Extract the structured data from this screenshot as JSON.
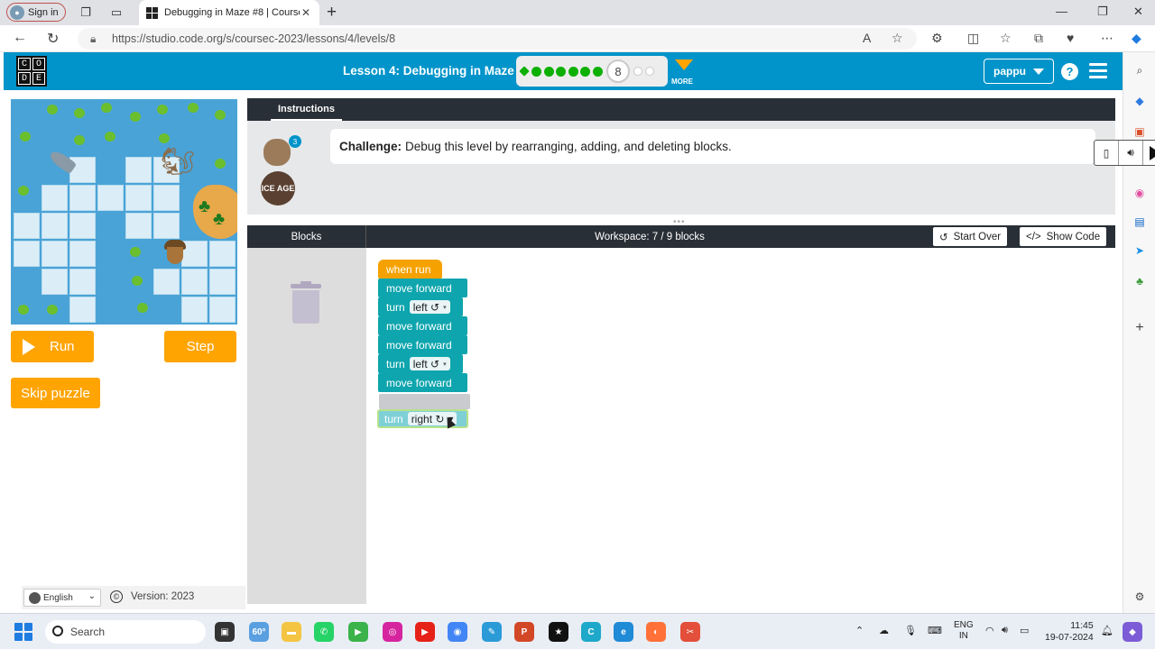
{
  "browser": {
    "signin_label": "Sign in",
    "tab_title": "Debugging in Maze #8 | Course C",
    "url": "https://studio.code.org/s/coursec-2023/lessons/4/levels/8"
  },
  "header": {
    "logo_letters": [
      "C",
      "O",
      "D",
      "E"
    ],
    "lesson_title": "Lesson 4: Debugging in Maze",
    "progress": {
      "completed_levels": 7,
      "current_level": "8",
      "remaining_levels": 2
    },
    "more_label": "MORE",
    "user_name": "pappu",
    "help_label": "?"
  },
  "maze": {
    "run_label": "Run",
    "step_label": "Step",
    "skip_label": "Skip puzzle"
  },
  "footer": {
    "language": "English",
    "copyright_symbol": "©",
    "version": "Version: 2023"
  },
  "instructions": {
    "tab_label": "Instructions",
    "badge_count": "3",
    "challenge_prefix": "Challenge:",
    "challenge_text": "Debug this level by rearranging, adding, and deleting blocks.",
    "ice_logo_text": "ICE AGE"
  },
  "workspace": {
    "blocks_label": "Blocks",
    "title": "Workspace: 7 / 9 blocks",
    "start_over_label": "Start Over",
    "show_code_label": "Show Code",
    "program": [
      {
        "kind": "event",
        "text": "when run"
      },
      {
        "kind": "move",
        "text": "move forward"
      },
      {
        "kind": "turn",
        "text": "turn",
        "option": "left ↺"
      },
      {
        "kind": "move",
        "text": "move forward"
      },
      {
        "kind": "move",
        "text": "move forward"
      },
      {
        "kind": "turn",
        "text": "turn",
        "option": "left ↺"
      },
      {
        "kind": "move",
        "text": "move forward"
      }
    ],
    "dragging_block": {
      "text": "turn",
      "option": "right ↻"
    }
  },
  "taskbar": {
    "search_placeholder": "Search",
    "weather": "60°",
    "language_line1": "ENG",
    "language_line2": "IN",
    "time": "11:45",
    "date": "19-07-2024"
  },
  "colors": {
    "codeorg_teal": "#0094ca",
    "event_block": "#f5a200",
    "move_block": "#0ea5ae",
    "orange_button": "#ffa400",
    "progress_green": "#0db000"
  }
}
